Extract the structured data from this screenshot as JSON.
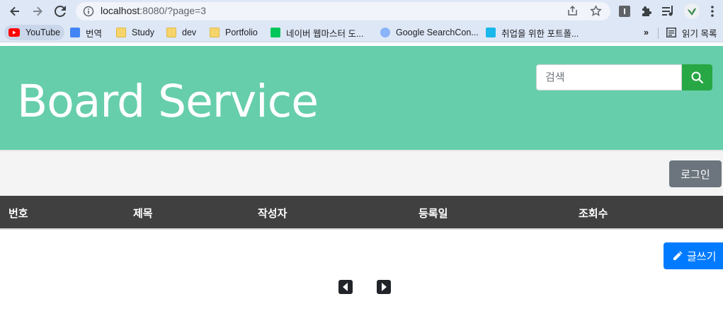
{
  "browser": {
    "url_host": "localhost",
    "url_rest": ":8080/?page=3",
    "bookmarks": [
      {
        "label": "YouTube",
        "icon": "youtube-icon"
      },
      {
        "label": "번역",
        "icon": "translate-icon"
      },
      {
        "label": "Study",
        "icon": "folder-icon"
      },
      {
        "label": "dev",
        "icon": "folder-icon"
      },
      {
        "label": "Portfolio",
        "icon": "folder-icon"
      },
      {
        "label": "네이버 웹마스터 도...",
        "icon": "naver-icon"
      },
      {
        "label": "Google SearchCon...",
        "icon": "google-search-console-icon"
      },
      {
        "label": "취업을 위한 포트폴...",
        "icon": "vimeo-icon"
      }
    ],
    "overflow_label": "»",
    "reading_list_label": "읽기 목록"
  },
  "header": {
    "title": "Board Service",
    "search_placeholder": "검색"
  },
  "actions": {
    "login_label": "로그인",
    "write_label": "글쓰기"
  },
  "table": {
    "columns": [
      "번호",
      "제목",
      "작성자",
      "등록일",
      "조회수"
    ]
  },
  "colors": {
    "hero": "#66ceaa",
    "search_button": "#28a745",
    "login_button": "#6c757d",
    "write_button": "#007bff",
    "table_header": "#404040"
  }
}
